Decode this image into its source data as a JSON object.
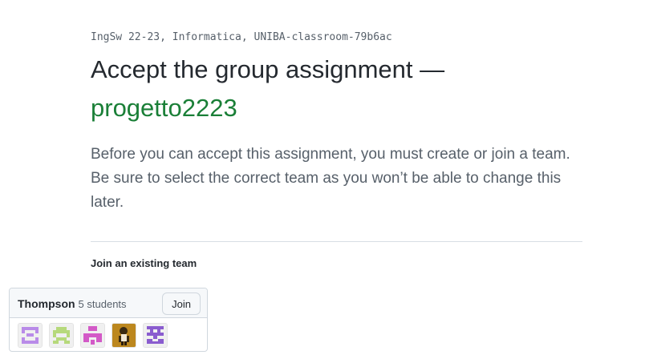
{
  "header": {
    "classroom": "IngSw 22-23, Informatica, UNIBA-classroom-79b6ac",
    "title_prefix": "Accept the group assignment —",
    "assignment_name": "progetto2223"
  },
  "intro": {
    "text": "Before you can accept this assignment, you must create or join a team. Be sure to select the correct team as you won’t be able to change this later."
  },
  "existing_teams": {
    "heading": "Join an existing team",
    "teams": [
      {
        "name": "Thompson",
        "count_label": "5 students",
        "join_label": "Join",
        "members": [
          {
            "avatar": "identicon-purple",
            "color": "#b98be8"
          },
          {
            "avatar": "identicon-green",
            "color": "#b6d97b"
          },
          {
            "avatar": "identicon-pink",
            "color": "#d35ac7"
          },
          {
            "avatar": "photo-avatar",
            "color": "#c79324"
          },
          {
            "avatar": "identicon-violet",
            "color": "#8a5ccf"
          }
        ]
      }
    ]
  }
}
